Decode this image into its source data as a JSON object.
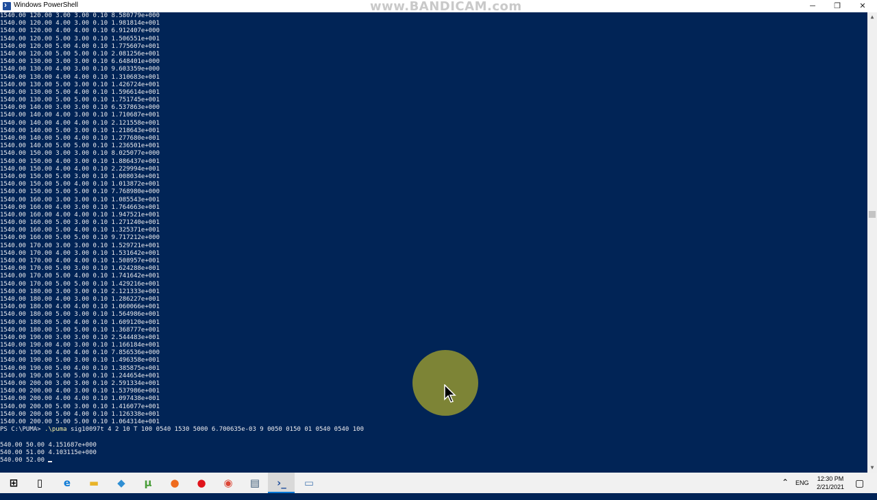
{
  "window": {
    "title": "Windows PowerShell",
    "watermark": "www.BANDICAM.com",
    "controls": {
      "minimize": "─",
      "maximize": "❐",
      "close": "✕"
    }
  },
  "terminal": {
    "output_lines": [
      "1540.00 120.00 3.00 3.00 0.10 8.580779e+000",
      "1540.00 120.00 4.00 3.00 0.10 1.981814e+001",
      "1540.00 120.00 4.00 4.00 0.10 6.912407e+000",
      "1540.00 120.00 5.00 3.00 0.10 1.506551e+001",
      "1540.00 120.00 5.00 4.00 0.10 1.775607e+001",
      "1540.00 120.00 5.00 5.00 0.10 2.081256e+001",
      "1540.00 130.00 3.00 3.00 0.10 6.648401e+000",
      "1540.00 130.00 4.00 3.00 0.10 9.603359e+000",
      "1540.00 130.00 4.00 4.00 0.10 1.310683e+001",
      "1540.00 130.00 5.00 3.00 0.10 1.426724e+001",
      "1540.00 130.00 5.00 4.00 0.10 1.596614e+001",
      "1540.00 130.00 5.00 5.00 0.10 1.751745e+001",
      "1540.00 140.00 3.00 3.00 0.10 6.537863e+000",
      "1540.00 140.00 4.00 3.00 0.10 1.710687e+001",
      "1540.00 140.00 4.00 4.00 0.10 2.121558e+001",
      "1540.00 140.00 5.00 3.00 0.10 1.218643e+001",
      "1540.00 140.00 5.00 4.00 0.10 1.277680e+001",
      "1540.00 140.00 5.00 5.00 0.10 1.236501e+001",
      "1540.00 150.00 3.00 3.00 0.10 8.025077e+000",
      "1540.00 150.00 4.00 3.00 0.10 1.886437e+001",
      "1540.00 150.00 4.00 4.00 0.10 2.229994e+001",
      "1540.00 150.00 5.00 3.00 0.10 1.008034e+001",
      "1540.00 150.00 5.00 4.00 0.10 1.013872e+001",
      "1540.00 150.00 5.00 5.00 0.10 7.768980e+000",
      "1540.00 160.00 3.00 3.00 0.10 1.085543e+001",
      "1540.00 160.00 4.00 3.00 0.10 1.764663e+001",
      "1540.00 160.00 4.00 4.00 0.10 1.947521e+001",
      "1540.00 160.00 5.00 3.00 0.10 1.271240e+001",
      "1540.00 160.00 5.00 4.00 0.10 1.325371e+001",
      "1540.00 160.00 5.00 5.00 0.10 9.717212e+000",
      "1540.00 170.00 3.00 3.00 0.10 1.529721e+001",
      "1540.00 170.00 4.00 3.00 0.10 1.531642e+001",
      "1540.00 170.00 4.00 4.00 0.10 1.508957e+001",
      "1540.00 170.00 5.00 3.00 0.10 1.624288e+001",
      "1540.00 170.00 5.00 4.00 0.10 1.741642e+001",
      "1540.00 170.00 5.00 5.00 0.10 1.429216e+001",
      "1540.00 180.00 3.00 3.00 0.10 2.121333e+001",
      "1540.00 180.00 4.00 3.00 0.10 1.286227e+001",
      "1540.00 180.00 4.00 4.00 0.10 1.060066e+001",
      "1540.00 180.00 5.00 3.00 0.10 1.564986e+001",
      "1540.00 180.00 5.00 4.00 0.10 1.609120e+001",
      "1540.00 180.00 5.00 5.00 0.10 1.368777e+001",
      "1540.00 190.00 3.00 3.00 0.10 2.544483e+001",
      "1540.00 190.00 4.00 3.00 0.10 1.166184e+001",
      "1540.00 190.00 4.00 4.00 0.10 7.856536e+000",
      "1540.00 190.00 5.00 3.00 0.10 1.496358e+001",
      "1540.00 190.00 5.00 4.00 0.10 1.385875e+001",
      "1540.00 190.00 5.00 5.00 0.10 1.244654e+001",
      "1540.00 200.00 3.00 3.00 0.10 2.591334e+001",
      "1540.00 200.00 4.00 3.00 0.10 1.537986e+001",
      "1540.00 200.00 4.00 4.00 0.10 1.097438e+001",
      "1540.00 200.00 5.00 3.00 0.10 1.416077e+001",
      "1540.00 200.00 5.00 4.00 0.10 1.126338e+001",
      "1540.00 200.00 5.00 5.00 0.10 1.064314e+001"
    ],
    "prompt": "PS C:\\PUMA> ",
    "command": ".\\puma",
    "command_args": " sig10097t 4 2 10 T 100 0540 1530 5000 6.700635e-03 9 0050 0150 01 0540 0540 100",
    "result_lines": [
      "540.00 50.00 4.151687e+000",
      "540.00 51.00 4.103115e+000"
    ],
    "current_line": "540.00 52.00 "
  },
  "taskbar": {
    "icons": [
      {
        "name": "start-icon",
        "glyph": "⊞",
        "color": "#000000"
      },
      {
        "name": "task-view-icon",
        "glyph": "▯",
        "color": "#000000"
      },
      {
        "name": "edge-icon",
        "glyph": "e",
        "color": "#0f7bd6"
      },
      {
        "name": "file-explorer-icon",
        "glyph": "▬",
        "color": "#e8b429"
      },
      {
        "name": "vscode-icon",
        "glyph": "◆",
        "color": "#2f8fd4"
      },
      {
        "name": "utorrent-icon",
        "glyph": "µ",
        "color": "#4a9e3a"
      },
      {
        "name": "firefox-icon",
        "glyph": "●",
        "color": "#ef6b1e"
      },
      {
        "name": "bandicam-record-icon",
        "glyph": "●",
        "color": "#e0141b"
      },
      {
        "name": "chrome-icon",
        "glyph": "◉",
        "color": "#dc4636"
      },
      {
        "name": "app-icon",
        "glyph": "▤",
        "color": "#3c5a78"
      },
      {
        "name": "powershell-icon",
        "glyph": "›_",
        "color": "#1f4e9d"
      },
      {
        "name": "notepad-icon",
        "glyph": "▭",
        "color": "#4f7fb5"
      }
    ],
    "tray": {
      "chevron": "⌃",
      "language": "ENG",
      "time": "12:30 PM",
      "date": "2/21/2021",
      "notification": "▢"
    }
  },
  "colors": {
    "console_bg": "#012456",
    "console_fg": "#eeedf0",
    "taskbar_bg": "#f1f1f1"
  }
}
